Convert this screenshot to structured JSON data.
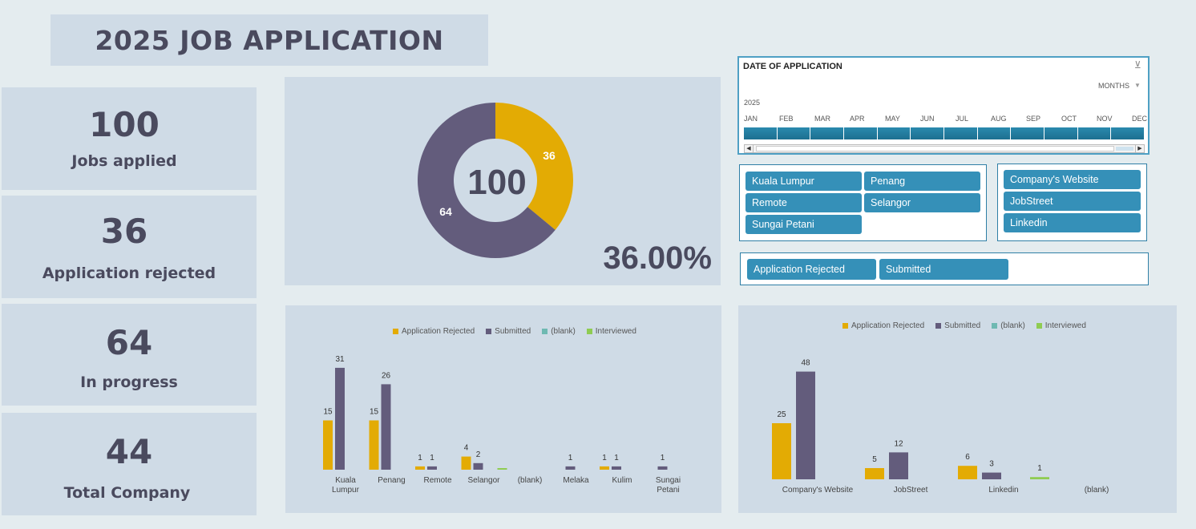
{
  "title": "2025 JOB APPLICATION",
  "kpis": [
    {
      "value": "100",
      "label": "Jobs applied"
    },
    {
      "value": "36",
      "label": "Application rejected"
    },
    {
      "value": "64",
      "label": "In progress"
    },
    {
      "value": "44",
      "label": "Total Company"
    }
  ],
  "donut": {
    "center": "100",
    "percent": "36.00%",
    "rejected": 36,
    "in_progress": 64,
    "rejected_label": "36",
    "in_progress_label": "64"
  },
  "timeline": {
    "title": "DATE OF APPLICATION",
    "level": "MONTHS",
    "year": "2025",
    "months": [
      "JAN",
      "FEB",
      "MAR",
      "APR",
      "MAY",
      "JUN",
      "JUL",
      "AUG",
      "SEP",
      "OCT",
      "NOV",
      "DEC"
    ]
  },
  "location_slicer": [
    "Kuala Lumpur",
    "Penang",
    "Remote",
    "Selangor",
    "Sungai Petani"
  ],
  "platform_slicer": [
    "Company's Website",
    "JobStreet",
    "Linkedin"
  ],
  "status_slicer": [
    "Application Rejected",
    "Submitted"
  ],
  "colors": {
    "rejected": "#e3ab04",
    "submitted": "#635c7c",
    "blank": "#6fb9b2",
    "interviewed": "#8fcc52",
    "slicer": "#3590b8"
  },
  "chart_data": [
    {
      "type": "bar",
      "legend": [
        "Application Rejected",
        "Submitted",
        "(blank)",
        "Interviewed"
      ],
      "categories": [
        "Kuala Lumpur",
        "Penang",
        "Remote",
        "Selangor",
        "(blank)",
        "Melaka",
        "Kulim",
        "Sungai Petani"
      ],
      "series": [
        {
          "name": "Application Rejected",
          "values": [
            15,
            15,
            1,
            4,
            null,
            null,
            1,
            null
          ]
        },
        {
          "name": "Submitted",
          "values": [
            31,
            26,
            1,
            2,
            null,
            1,
            1,
            1
          ]
        },
        {
          "name": "(blank)",
          "values": [
            null,
            null,
            null,
            null,
            null,
            null,
            null,
            null
          ]
        },
        {
          "name": "Interviewed",
          "values": [
            null,
            null,
            null,
            0.4,
            null,
            null,
            null,
            null
          ]
        }
      ]
    },
    {
      "type": "bar",
      "legend": [
        "Application Rejected",
        "Submitted",
        "(blank)",
        "Interviewed"
      ],
      "categories": [
        "Company's Website",
        "JobStreet",
        "Linkedin",
        "(blank)"
      ],
      "series": [
        {
          "name": "Application Rejected",
          "values": [
            25,
            5,
            6,
            null
          ]
        },
        {
          "name": "Submitted",
          "values": [
            48,
            12,
            3,
            null
          ]
        },
        {
          "name": "(blank)",
          "values": [
            null,
            null,
            null,
            null
          ]
        },
        {
          "name": "Interviewed",
          "values": [
            null,
            null,
            1,
            null
          ]
        }
      ]
    }
  ]
}
